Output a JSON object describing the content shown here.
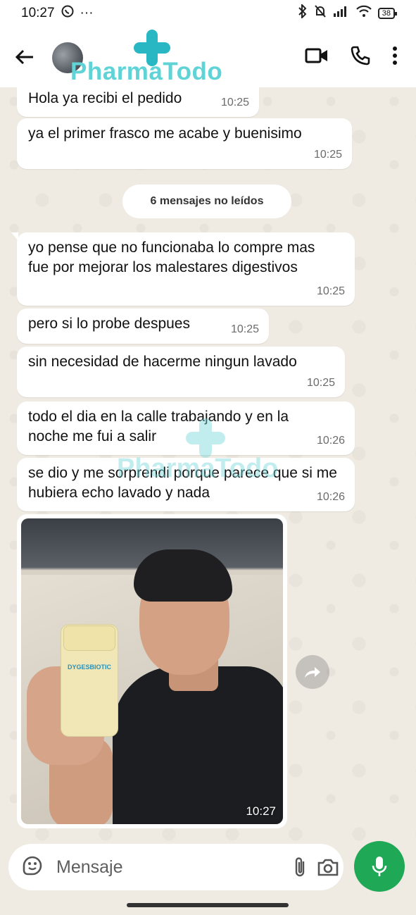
{
  "status_bar": {
    "time": "10:27",
    "dots": "···",
    "battery": "38"
  },
  "header": {
    "brand_name": "PharmaTodo",
    "icons": [
      "back-arrow-icon",
      "video-call-icon",
      "phone-icon",
      "more-options-icon"
    ],
    "colors": {
      "brand": "#5fd3d6",
      "brand_plus": "#29b7c3"
    }
  },
  "messages": [
    {
      "text": "Hola ya recibi el pedido",
      "time": "10:25"
    },
    {
      "text": "ya el primer frasco me acabe y buenisimo",
      "time": "10:25"
    },
    {
      "text": "yo pense que no funcionaba lo compre mas fue por mejorar los malestares digestivos",
      "time": "10:25"
    },
    {
      "text": "pero si lo probe despues",
      "time": "10:25"
    },
    {
      "text": "sin necesidad de hacerme ningun lavado",
      "time": "10:25"
    },
    {
      "text": "todo el dia en la calle trabajando y en la noche me fui a salir",
      "time": "10:26"
    },
    {
      "text": "se dio y me sorprendi porque parece que si me hubiera echo lavado y nada",
      "time": "10:26"
    }
  ],
  "unread_banner": "6 mensajes no leídos",
  "photo": {
    "time": "10:27",
    "bottle_label": "DYGESBIOTIC"
  },
  "watermark": "PharmaTodo",
  "input": {
    "placeholder": "Mensaje"
  },
  "colors": {
    "chat_bg": "#efeae2",
    "mic_button": "#1fa855",
    "bubble": "#ffffff"
  }
}
